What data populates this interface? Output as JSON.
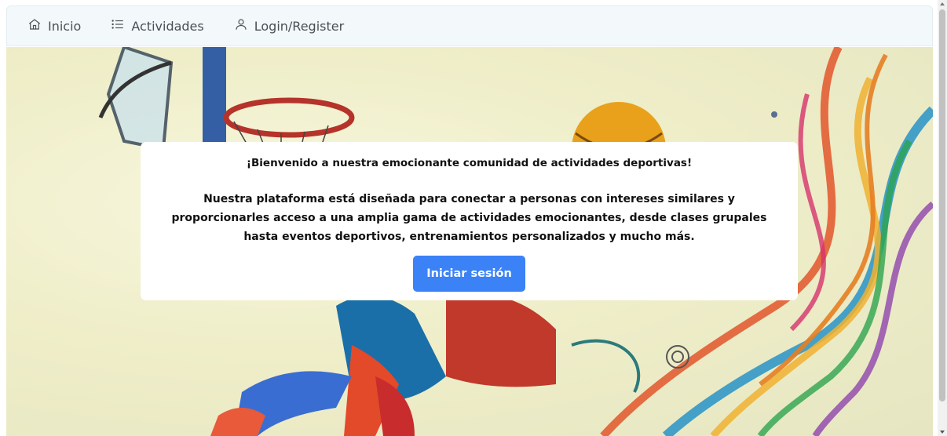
{
  "nav": {
    "items": [
      {
        "label": "Inicio",
        "icon": "home-icon"
      },
      {
        "label": "Actividades",
        "icon": "list-icon"
      },
      {
        "label": "Login/Register",
        "icon": "user-icon"
      }
    ]
  },
  "hero": {
    "welcome": "¡Bienvenido a nuestra emocionante comunidad de actividades deportivas!",
    "description": "Nuestra plataforma está diseñada para conectar a personas con intereses similares y proporcionarles acceso a una amplia gama de actividades emocionantes, desde clases grupales hasta eventos deportivos, entrenamientos personalizados y mucho más.",
    "button_label": "Iniciar sesión"
  },
  "colors": {
    "accent": "#3b82f6",
    "navbar_bg": "#f3f9fb"
  }
}
